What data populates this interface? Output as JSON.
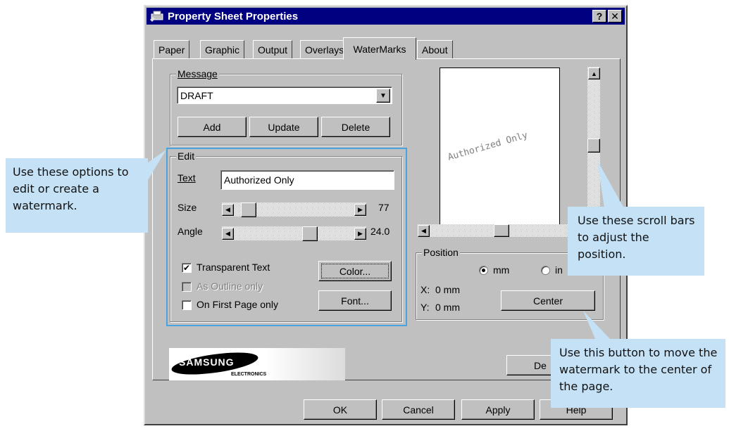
{
  "window": {
    "title": "Property Sheet Properties",
    "help_label": "?",
    "close_label": "✕"
  },
  "tabs": [
    {
      "label": "Paper"
    },
    {
      "label": "Graphic"
    },
    {
      "label": "Output"
    },
    {
      "label": "Overlays"
    },
    {
      "label": "WaterMarks"
    },
    {
      "label": "About"
    }
  ],
  "active_tab": "WaterMarks",
  "message": {
    "group_label": "Message",
    "selected": "DRAFT",
    "add_label": "Add",
    "update_label": "Update",
    "delete_label": "Delete"
  },
  "edit": {
    "group_label": "Edit",
    "text_label": "Text",
    "text_value": "Authorized Only",
    "size_label": "Size",
    "size_value": "77",
    "angle_label": "Angle",
    "angle_value": "24.0",
    "transparent_label": "Transparent Text",
    "transparent_checked": true,
    "outline_label": "As Outline only",
    "outline_checked": false,
    "first_page_label": "On First Page only",
    "first_page_checked": false,
    "color_label": "Color...",
    "font_label": "Font..."
  },
  "preview": {
    "watermark_text": "Authorized Only"
  },
  "position": {
    "group_label": "Position",
    "mm_label": "mm",
    "inch_label": "in",
    "x_label": "X:",
    "x_value": "0 mm",
    "y_label": "Y:",
    "y_value": "0 mm",
    "center_label": "Center"
  },
  "logo": {
    "brand": "SAMSUNG",
    "sub": "ELECTRONICS"
  },
  "default_label": "De",
  "footer": {
    "ok_label": "OK",
    "cancel_label": "Cancel",
    "apply_label": "Apply",
    "help_label": "Help"
  },
  "callouts": {
    "edit": "Use these options to edit or create a watermark.",
    "scroll": "Use these scroll bars to adjust the position.",
    "center": "Use this button to move the watermark to the center of the page."
  },
  "colors": {
    "window_face": "#c0c0c0",
    "titlebar": "#000080",
    "callout_bg": "#c5e1f5",
    "highlight": "#4aa3df"
  }
}
